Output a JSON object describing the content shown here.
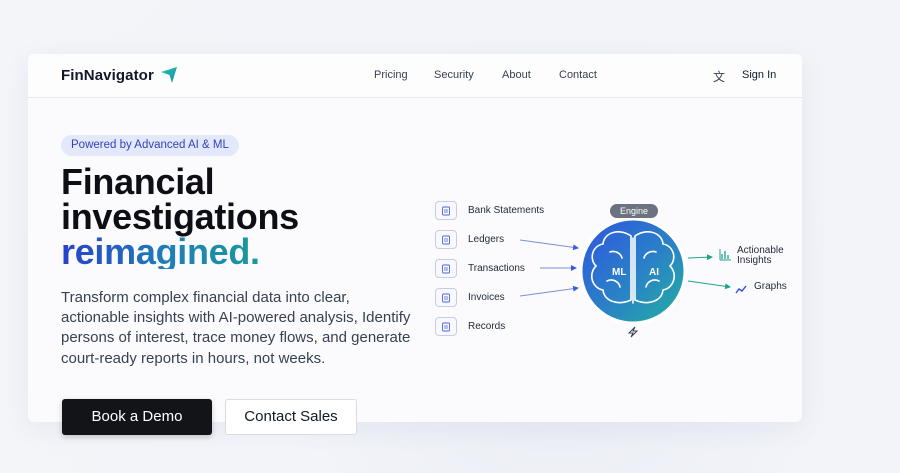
{
  "nav": {
    "brand": "FinNavigator",
    "links": [
      "Pricing",
      "Security",
      "About",
      "Contact"
    ],
    "language_icon": "translate-icon",
    "sign_in": "Sign In"
  },
  "hero": {
    "badge": "Powered by Advanced AI & ML",
    "headline_line1": "Financial",
    "headline_line2": "investigations",
    "headline_line3": "reimagined.",
    "subtext": "Transform complex financial data into clear, actionable insights with AI-powered analysis, Identify persons of interest, trace money flows, and generate court-ready reports in hours, not weeks.",
    "cta_primary": "Book a Demo",
    "cta_secondary": "Contact Sales"
  },
  "diagram": {
    "sources": [
      "Bank Statements",
      "Ledgers",
      "Transactions",
      "Invoices",
      "Records"
    ],
    "engine_label": "Engine",
    "brain_left": "ML",
    "brain_right": "AI",
    "outputs": [
      {
        "label_line1": "Actionable",
        "label_line2": "Insights",
        "icon": "bar-chart-icon"
      },
      {
        "label_line1": "Graphs",
        "label_line2": "",
        "icon": "trend-line-icon"
      }
    ],
    "footer_icon": "lightning-icon"
  },
  "colors": {
    "accent_blue": "#2741c8",
    "accent_teal": "#17a58c",
    "badge_bg": "#e4e8fb",
    "button_dark": "#121418"
  }
}
